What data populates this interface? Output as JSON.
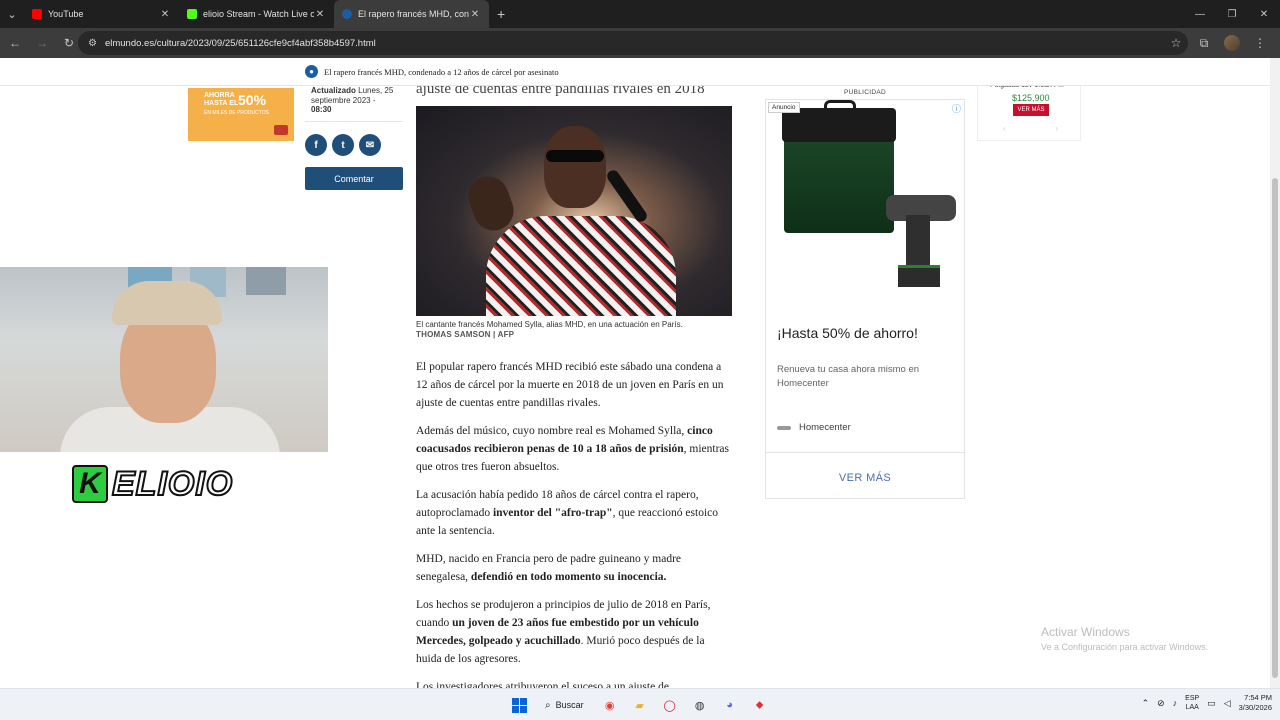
{
  "browser": {
    "tabs": [
      {
        "label": "YouTube",
        "favicon_color": "#ff0000",
        "active": false
      },
      {
        "label": "elioio Stream - Watch Live on Ki",
        "favicon_color": "#53fc18",
        "active": false
      },
      {
        "label": "El rapero francés MHD, condena",
        "favicon_color": "#1b5ea0",
        "active": true
      }
    ],
    "url": "elmundo.es/cultura/2023/09/25/651126cfe9cf4abf358b4597.html"
  },
  "sticky_header": {
    "title": "El rapero francés MHD, condenado a 12 años de cárcel por asesinato"
  },
  "promo": {
    "line1": "AHORRA",
    "line2": "HASTA EL",
    "percent": "50%",
    "line3": "EN MILES DE PRODUCTOS"
  },
  "article": {
    "updated_label": "Actualizado",
    "updated_date": "Lunes, 25 septiembre 2023 -",
    "updated_time": "08:30",
    "comment_label": "Comentar",
    "subhead": "ajuste de cuentas entre pandillas rivales en 2018",
    "caption": "El cantante francés Mohamed Sylla, alias MHD, en una actuación en París.",
    "credit": "THOMAS SAMSON | AFP",
    "p1": "El popular rapero francés MHD recibió este sábado una condena a 12 años de cárcel por la muerte en 2018 de un joven en París en un ajuste de cuentas entre pandillas rivales.",
    "p2_a": "Además del músico, cuyo nombre real es Mohamed Sylla, ",
    "p2_b": "cinco coacusados recibieron penas de 10 a 18 años de prisión",
    "p2_c": ", mientras que otros tres fueron absueltos.",
    "p3_a": "La acusación había pedido 18 años de cárcel contra el rapero, autoproclamado ",
    "p3_b": "inventor del \"afro-trap\"",
    "p3_c": ", que reaccionó estoico ante la sentencia.",
    "p4_a": "MHD, nacido en Francia pero de padre guineano y madre senegalesa, ",
    "p4_b": "defendió en todo momento su inocencia.",
    "p5_a": "Los hechos se produjeron a principios de julio de 2018 en París, cuando ",
    "p5_b": "un joven de 23 años fue embestido por un vehículo Mercedes, golpeado y acuchillado",
    "p5_c": ". Murió poco después de la huida de los agresores.",
    "p6": "Los investigadores atribuyeron el suceso a un ajuste de"
  },
  "ad": {
    "label": "PUBLICIDAD",
    "badge": "Anuncio",
    "headline": "¡Hasta 50% de ahorro!",
    "description": "Renueva tu casa ahora mismo en Homecenter",
    "brand": "Homecenter",
    "cta": "VER MÁS"
  },
  "product_card": {
    "name": "Pulgadas 12v 1.5ah I-...",
    "price": "$125,900",
    "button": "VER MÁS"
  },
  "stream_logo": {
    "k": "K",
    "word": "ELIOIO"
  },
  "windows_watermark": {
    "title": "Activar Windows",
    "subtitle": "Ve a Configuración para activar Windows."
  },
  "taskbar": {
    "search_label": "Buscar",
    "lang_line1": "ESP",
    "lang_line2": "LAA",
    "time": "7:54 PM",
    "date": "3/30/2026"
  }
}
